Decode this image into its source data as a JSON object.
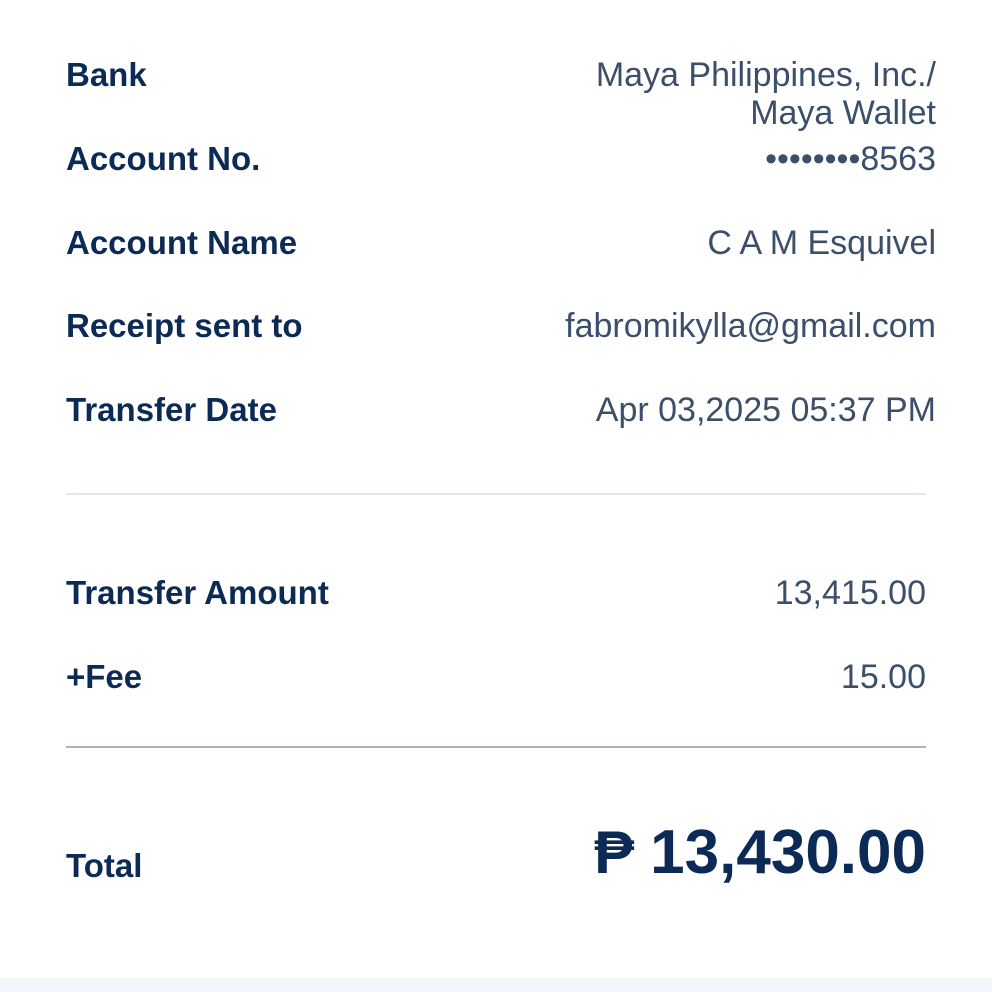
{
  "details": [
    {
      "label": "Bank",
      "value_lines": [
        "Maya Philippines, Inc./",
        "Maya Wallet"
      ]
    },
    {
      "label": "Account No.",
      "value": "••••••••8563"
    },
    {
      "label": "Account Name",
      "value": "C A M Esquivel"
    },
    {
      "label": "Receipt sent to",
      "value": "fabromikylla@gmail.com"
    },
    {
      "label": "Transfer Date",
      "value": "Apr 03,2025 05:37 PM"
    }
  ],
  "amounts": {
    "transfer_label": "Transfer Amount",
    "transfer_value": "13,415.00",
    "fee_label": "+Fee",
    "fee_value": "15.00"
  },
  "total": {
    "label": "Total",
    "currency_symbol": "₱",
    "value": "13,430.00"
  },
  "colors": {
    "label": "#0b2a55",
    "value": "#3b4f6b",
    "divider_light": "#e3e8ee",
    "divider_dark": "#a7b4c4"
  }
}
